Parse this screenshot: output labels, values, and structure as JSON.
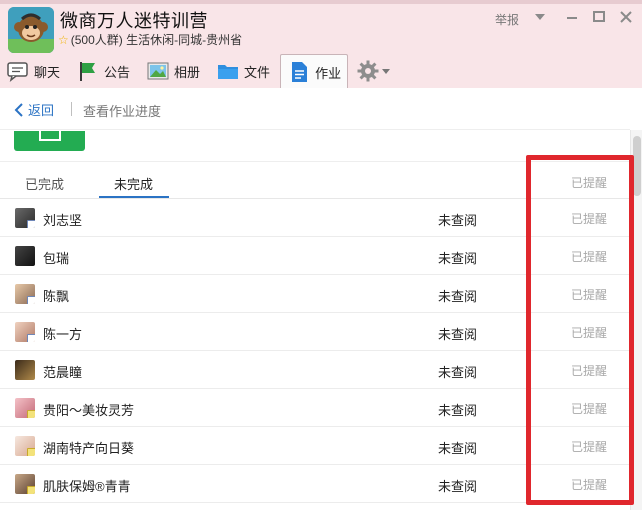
{
  "header": {
    "group_title": "微商万人迷特训营",
    "group_subtitle": "(500人群) 生活休闲-同城-贵州省",
    "report_label": "举报"
  },
  "tabs": [
    {
      "label": "聊天",
      "icon": "chat-icon"
    },
    {
      "label": "公告",
      "icon": "announcement-flag-icon"
    },
    {
      "label": "相册",
      "icon": "photo-album-icon"
    },
    {
      "label": "文件",
      "icon": "folder-icon"
    },
    {
      "label": "作业",
      "icon": "homework-document-icon",
      "active": true
    }
  ],
  "navbar": {
    "back_label": "返回",
    "page_title": "查看作业进度"
  },
  "subtabs": {
    "completed": "已完成",
    "incomplete": "未完成",
    "active": "incomplete",
    "remind_header": "已提醒"
  },
  "rows": [
    {
      "name": "刘志坚",
      "status": "未查阅",
      "remind": "已提醒"
    },
    {
      "name": "包瑞",
      "status": "未查阅",
      "remind": "已提醒"
    },
    {
      "name": "陈飘",
      "status": "未查阅",
      "remind": "已提醒"
    },
    {
      "name": "陈一方",
      "status": "未查阅",
      "remind": "已提醒"
    },
    {
      "name": "范晨瞳",
      "status": "未查阅",
      "remind": "已提醒"
    },
    {
      "name": "贵阳～美妆灵芳",
      "status": "未查阅",
      "remind": "已提醒"
    },
    {
      "name": "湖南特产向日葵",
      "status": "未查阅",
      "remind": "已提醒"
    },
    {
      "name": "肌肤保姆®青青",
      "status": "未查阅",
      "remind": "已提醒"
    }
  ],
  "colors": {
    "accent": "#2b73c4",
    "header_bg": "#f9e5e8",
    "highlight": "#e0272d",
    "reminded_text": "#a8a8a8"
  }
}
